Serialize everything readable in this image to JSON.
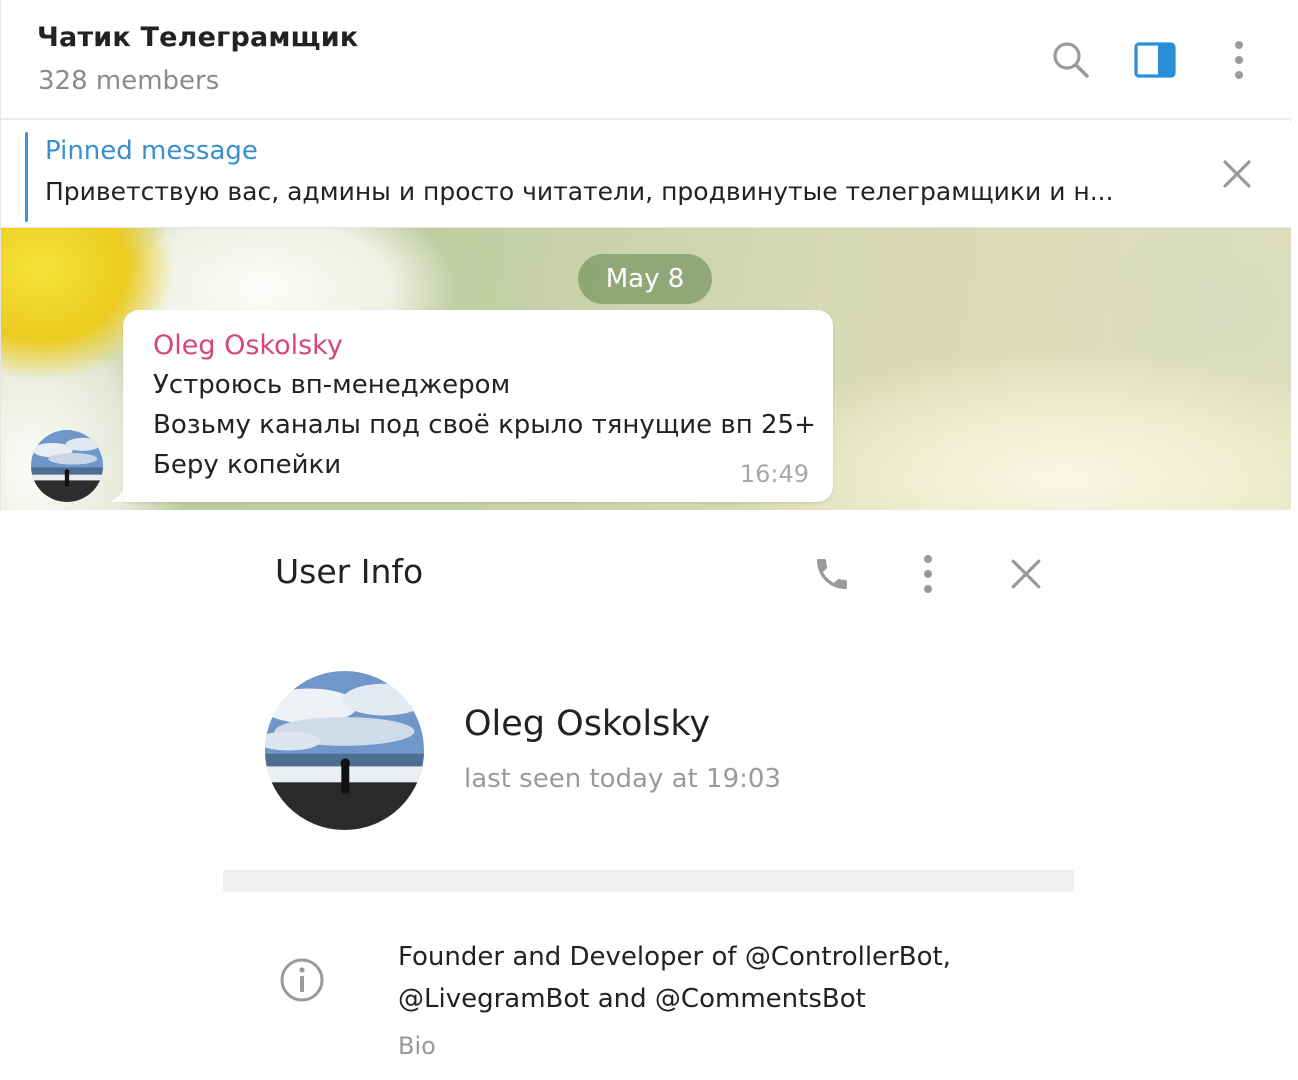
{
  "chat": {
    "title": "Чатик Телеграмщик",
    "subtitle": "328 members",
    "header_icons": [
      "search-icon",
      "sidebar-panel-icon",
      "more-vertical-icon"
    ],
    "accent_color": "#3b95d6"
  },
  "pinned": {
    "title": "Pinned message",
    "text": "Приветствую вас,  админы и просто читатели, продвинутые телеграмщики и н..."
  },
  "messages": {
    "date": "May 8",
    "items": [
      {
        "author": "Oleg Oskolsky",
        "author_color": "#d4467d",
        "lines": [
          "Устроюсь вп-менеджером",
          "Возьму каналы под своё крыло тянущие вп 25+",
          "Беру копейки"
        ],
        "time": "16:49"
      }
    ]
  },
  "user_info": {
    "title": "User Info",
    "icons": [
      "phone-icon",
      "more-vertical-icon",
      "close-icon"
    ],
    "name": "Oleg Oskolsky",
    "status": "last seen today at 19:03",
    "bio_lines": [
      "Founder and Developer of @ControllerBot,",
      "@LivegramBot and @CommentsBot"
    ],
    "bio_label": "Bio"
  }
}
